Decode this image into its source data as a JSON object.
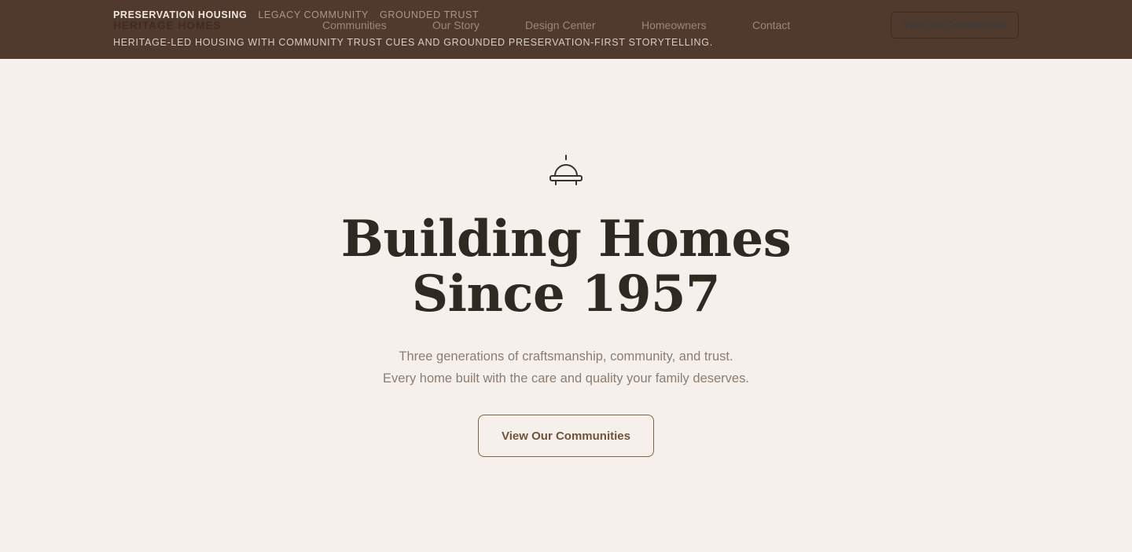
{
  "header": {
    "tags": [
      "Preservation Housing",
      "Legacy Community",
      "Grounded Trust"
    ],
    "brand": "Heritage Homes",
    "tagline": "Heritage-led housing with community trust cues and grounded preservation-first storytelling.",
    "nav": [
      "Communities",
      "Our Story",
      "Design Center",
      "Homeowners",
      "Contact"
    ],
    "cta_label": "View Our Communities"
  },
  "hero": {
    "icon": "dome-bell-icon",
    "title_line1": "Building Homes",
    "title_line2": "Since 1957",
    "subtitle_line1": "Three generations of craftsmanship, community, and trust.",
    "subtitle_line2": "Every home built with the care and quality your family deserves.",
    "cta_label": "View Our Communities"
  },
  "colors": {
    "header_bg": "#4f3a2d",
    "page_bg": "#f5f0eb",
    "accent": "#7d6348"
  }
}
